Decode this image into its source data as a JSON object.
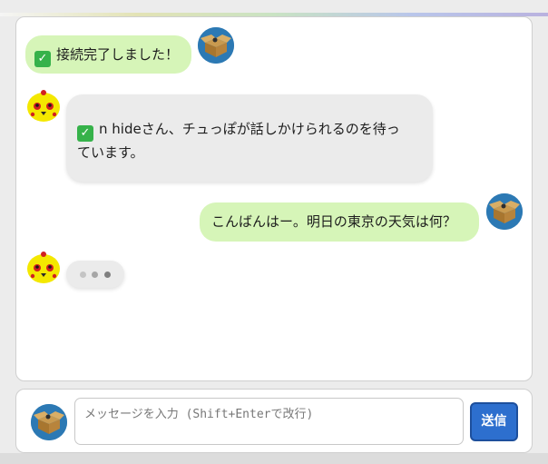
{
  "messages": [
    {
      "sender": "bot-status",
      "check": "✓",
      "text": "接続完了しました！"
    },
    {
      "sender": "bot",
      "check": "✓",
      "line1": "n hideさん、チュっぽが話しかけられるのを待っ",
      "line2": "ています。"
    },
    {
      "sender": "user",
      "text": "こんばんはー。明日の東京の天気は何？"
    },
    {
      "sender": "bot",
      "typing": true
    }
  ],
  "composer": {
    "placeholder": "メッセージを入力 (Shift+Enterで改行)",
    "send_label": "送信"
  },
  "colors": {
    "user_bubble": "#d6f5b8",
    "bot_bubble": "#ebebeb",
    "send_button": "#2d6fce",
    "user_avatar_bg": "#2c79b4"
  },
  "icons": {
    "user_avatar": "box-avatar-icon",
    "bot_avatar": "chick-avatar-icon",
    "check": "check-mark-icon"
  }
}
